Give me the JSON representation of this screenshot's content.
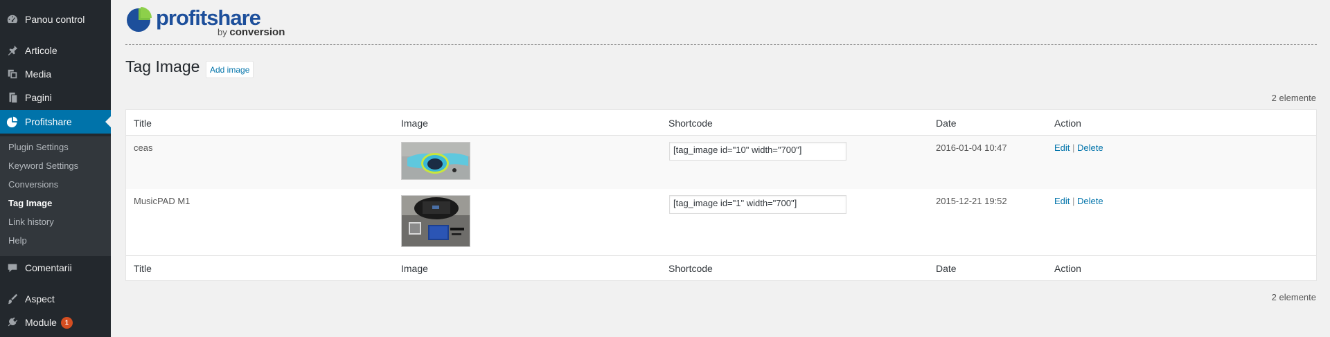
{
  "sidebar": {
    "items": [
      {
        "label": "Panou control",
        "icon": "dashboard-icon"
      },
      {
        "label": "Articole",
        "icon": "pin-icon"
      },
      {
        "label": "Media",
        "icon": "media-icon"
      },
      {
        "label": "Pagini",
        "icon": "pages-icon"
      },
      {
        "label": "Profitshare",
        "icon": "pie-chart-icon"
      },
      {
        "label": "Comentarii",
        "icon": "comment-icon"
      },
      {
        "label": "Aspect",
        "icon": "brush-icon"
      },
      {
        "label": "Module",
        "icon": "plugin-icon",
        "badge": "1"
      }
    ],
    "submenu": [
      "Plugin Settings",
      "Keyword Settings",
      "Conversions",
      "Tag Image",
      "Link history",
      "Help"
    ]
  },
  "logo": {
    "word": "profitshare",
    "by": "by",
    "brand": "conversion"
  },
  "page": {
    "title": "Tag Image",
    "add_button": "Add image",
    "count_top": "2 elemente",
    "count_bottom": "2 elemente"
  },
  "table": {
    "columns": [
      "Title",
      "Image",
      "Shortcode",
      "Date",
      "Action"
    ],
    "rows": [
      {
        "title": "ceas",
        "shortcode": "[tag_image id=\"10\" width=\"700\"]",
        "date": "2016-01-04 10:47",
        "edit": "Edit",
        "sep": "|",
        "delete": "Delete"
      },
      {
        "title": "MusicPAD M1",
        "shortcode": "[tag_image id=\"1\" width=\"700\"]",
        "date": "2015-12-21 19:52",
        "edit": "Edit",
        "sep": "|",
        "delete": "Delete"
      }
    ]
  },
  "colors": {
    "sidebar": "#23282d",
    "active": "#0073aa",
    "link": "#0073aa",
    "badge": "#d54e21"
  }
}
